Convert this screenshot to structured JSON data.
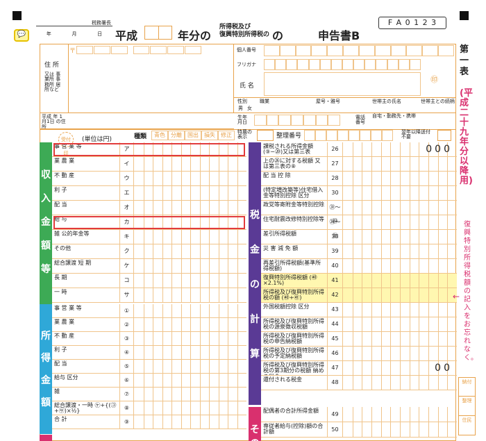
{
  "header": {
    "tax_office": "税務署長",
    "year_label": "年",
    "month_label": "月",
    "day_label": "日",
    "era": "平成",
    "year_of": "年分の",
    "tax_types_1": "所得税及び",
    "tax_types_2": "復興特別所得税の",
    "title": "申告書B",
    "form_code": "F A 0 1 2 3"
  },
  "personal": {
    "address_label": "住 所",
    "address_note": "又は 事業所 事務所 居所など",
    "postal_mark": "〒",
    "jan1_label": "平成 年 1月1日 の住所",
    "name_number": "個人番号",
    "furigana": "フリガナ",
    "name": "氏 名",
    "sex": "性別",
    "sex_m": "男",
    "sex_f": "女",
    "occupation": "職業",
    "trade_name": "屋号・雅号",
    "head_name": "世帯主の氏名",
    "head_relation": "世帯主との続柄",
    "birth": "生年月日",
    "phone": "電話番号",
    "phone_opts": "自宅・勤務先・携帯",
    "seal": "㊞"
  },
  "kinds": {
    "label": "種類",
    "items": [
      "青色",
      "分離",
      "国出",
      "損失",
      "修正"
    ],
    "special": "特農の表示",
    "ordinal": "整理番号",
    "reserve": "翌年以降送付不要"
  },
  "unit": "(単位は円)",
  "uketsuke": "受付印",
  "income_section": {
    "label": "収入金額等",
    "rows": [
      {
        "label": "事 営 業 等",
        "mark": "ア",
        "highlight": true
      },
      {
        "label": "業 農 業",
        "mark": "イ"
      },
      {
        "label": "不 動 産",
        "mark": "ウ"
      },
      {
        "label": "利 子",
        "mark": "エ"
      },
      {
        "label": "配 当",
        "mark": "オ"
      },
      {
        "label": "給 与",
        "mark": "カ",
        "highlight": true
      },
      {
        "label": "雑 公的年金等",
        "mark": "キ"
      },
      {
        "label": "その他",
        "mark": "ク"
      },
      {
        "label": "総合譲渡 短 期",
        "mark": "ケ"
      },
      {
        "label": "長 期",
        "mark": "コ"
      },
      {
        "label": "一 時",
        "mark": "サ"
      }
    ]
  },
  "shotoku_section": {
    "label": "所得金額",
    "rows": [
      {
        "label": "事 営 業 等",
        "mark": "①"
      },
      {
        "label": "業 農 業",
        "mark": "②"
      },
      {
        "label": "不 動 産",
        "mark": "③"
      },
      {
        "label": "利 子",
        "mark": "④"
      },
      {
        "label": "配 当",
        "mark": "⑤"
      },
      {
        "label": "給与 区分",
        "mark": "⑥"
      },
      {
        "label": "雑",
        "mark": "⑦"
      },
      {
        "label": "総合譲渡・一時 ㋘+{(㋙+㋚)×½}",
        "mark": "⑧"
      },
      {
        "label": "合 計",
        "mark": "⑨"
      }
    ]
  },
  "tax_section": {
    "label": "税金の計算",
    "rows": [
      {
        "label": "課税される所得金額 (⑨−⑳)又は第三表",
        "mark": "26",
        "value": "000"
      },
      {
        "label": "上の㉖に対する税額 又は第三表の⑧",
        "mark": "27"
      },
      {
        "label": "配 当 控 除",
        "mark": "28"
      },
      {
        "label": "(特定増改築等)住宅借入金等特別控除 区分",
        "mark": "30"
      },
      {
        "label": "政党等寄附金等特別控除",
        "mark": "㉛〜㉝"
      },
      {
        "label": "住宅耐震改修特別控除等",
        "mark": "㉞〜㊲"
      },
      {
        "label": "差引所得税額",
        "mark": "38"
      },
      {
        "label": "災 害 減 免 額",
        "mark": "39"
      },
      {
        "label": "再差引所得税額(基準所得税額)",
        "mark": "40"
      },
      {
        "label": "復興特別所得税額 (㊵×2.1%)",
        "mark": "41",
        "yellow": true
      },
      {
        "label": "所得税及び復興特別所得税の額 (㊵+㊶)",
        "mark": "42",
        "yellow": true
      },
      {
        "label": "外国税額控除 区分",
        "mark": "43"
      },
      {
        "label": "所得税及び復興特別所得税の源泉徴収税額",
        "mark": "44"
      },
      {
        "label": "所得税及び復興特別所得税の申告納税額",
        "mark": "45"
      },
      {
        "label": "所得税及び復興特別所得税の予定納税額",
        "mark": "46"
      },
      {
        "label": "所得税及び復興特別所得税の第3期分の税額 納める税金",
        "mark": "47",
        "value": "00"
      },
      {
        "label": "還付される税金",
        "mark": "48"
      }
    ]
  },
  "other_section": {
    "label": "その他",
    "rows": [
      {
        "label": "配偶者の合計所得金額",
        "mark": "49"
      },
      {
        "label": "専従者給与(控除)額の合計額",
        "mark": "50"
      }
    ]
  },
  "right_margin": {
    "label1": "第一表",
    "label2": "(平成二十九年分以降用)",
    "reminder": "復興特別所得税額の記入をお忘れなく。",
    "arrow": "←",
    "boxes": [
      "納付",
      "整理",
      "住民"
    ]
  }
}
